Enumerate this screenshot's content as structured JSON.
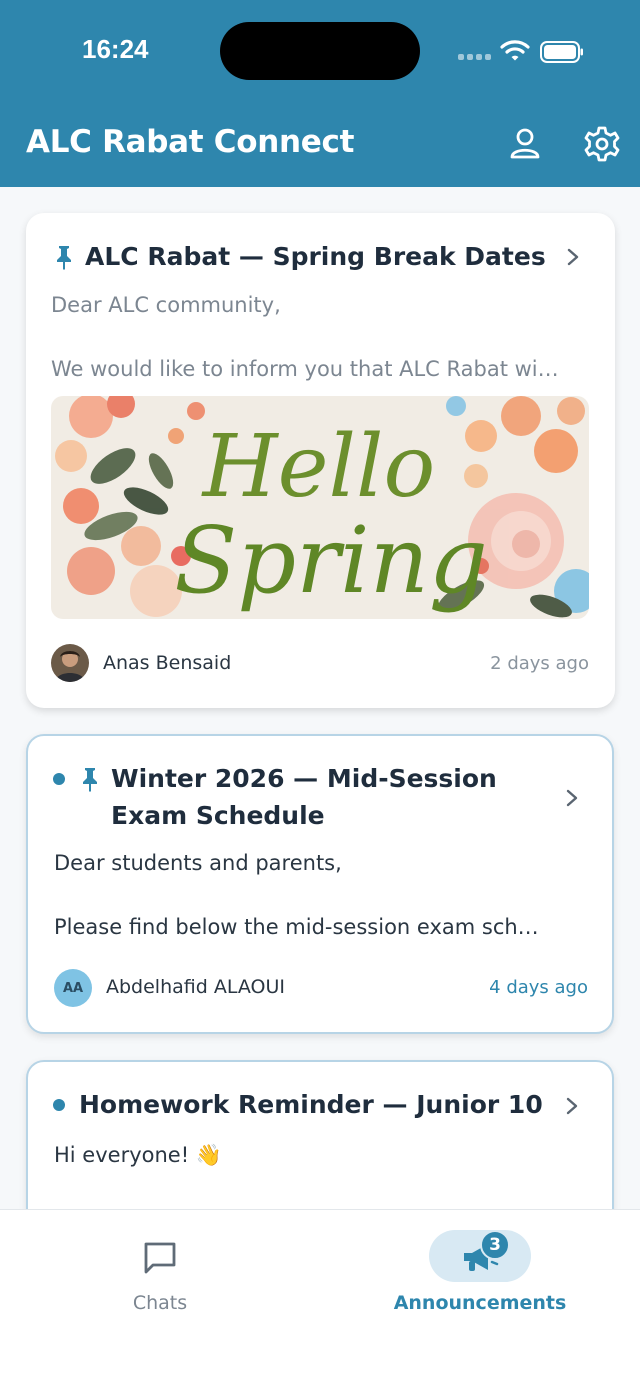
{
  "status_bar": {
    "time": "16:24"
  },
  "header": {
    "title": "ALC Rabat Connect",
    "profile_icon": "person-icon",
    "settings_icon": "gear-icon",
    "background": "#2e86ad"
  },
  "announcements": [
    {
      "title": "ALC Rabat — Spring Break Dates",
      "pinned": true,
      "unread": false,
      "preview_line_1": "Dear ALC community,",
      "preview_line_2": "We would like to inform you that ALC Rabat wi…",
      "image_text_1": "Hello",
      "image_text_2": "Spring",
      "author": "Anas Bensaid",
      "time": "2 days ago"
    },
    {
      "title_line_1": "Winter 2026 — Mid-Session",
      "title_line_2": "Exam Schedule",
      "pinned": true,
      "unread": true,
      "preview_line_1": "Dear students and parents,",
      "preview_line_2": "Please find below the mid-session exam sch…",
      "author_initials": "AA",
      "author": "Abdelhafid ALAOUI",
      "time": "4 days ago"
    },
    {
      "title": "Homework Reminder — Junior 10",
      "pinned": false,
      "unread": true,
      "preview_line_1": "Hi everyone! 👋"
    }
  ],
  "tabs": {
    "chats_label": "Chats",
    "announcements_label": "Announcements",
    "announcements_badge": "3",
    "active": "Announcements"
  },
  "colors": {
    "accent": "#2e86ad",
    "unread_border": "#b7d4e6",
    "active_tab_pill": "#d8e9f3"
  }
}
